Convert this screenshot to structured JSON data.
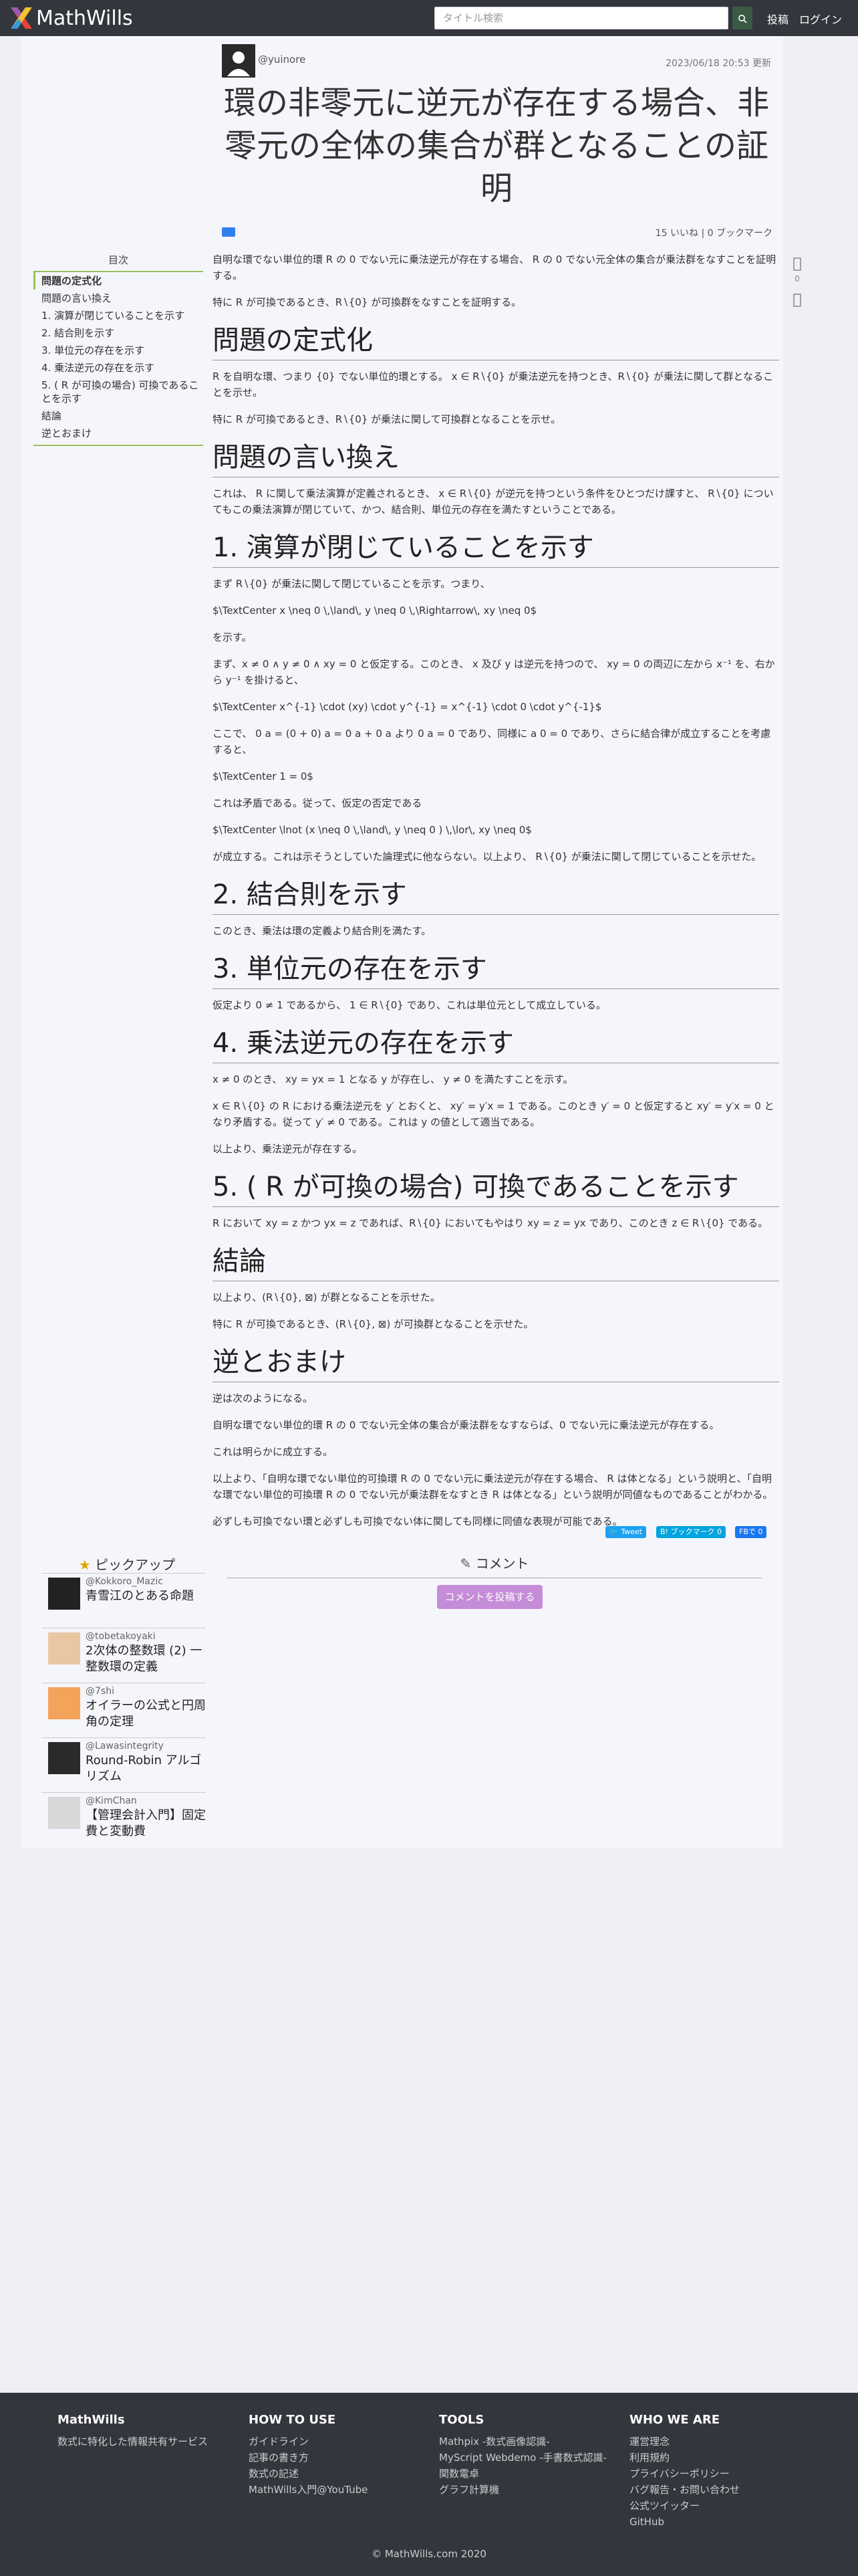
{
  "header": {
    "brand": "MathWills",
    "search_placeholder": "タイトル検索",
    "post_label": "投稿",
    "login_label": "ログイン"
  },
  "article": {
    "author": "@yuinore",
    "updated": "2023/06/18 20:53 更新",
    "title": "環の非零元に逆元が存在する場合、非零元の全体の集合が群となることの証明",
    "likes": "15 いいね",
    "bookmarks": "0 ブックマーク",
    "blocks": [
      {
        "type": "p",
        "text": "自明な環でない単位的環 R の 0 でない元に乗法逆元が存在する場合、 R の 0 でない元全体の集合が乗法群をなすことを証明する。"
      },
      {
        "type": "p",
        "text": "特に R が可換であるとき、R∖{0} が可換群をなすことを証明する。"
      },
      {
        "type": "h2",
        "text": "問題の定式化"
      },
      {
        "type": "p",
        "text": "R を自明な環、つまり {0} でない単位的環とする。 x ∈ R∖{0} が乗法逆元を持つとき、R∖{0} が乗法に関して群となることを示せ。"
      },
      {
        "type": "p",
        "text": "特に R が可換であるとき、R∖{0} が乗法に関して可換群となることを示せ。"
      },
      {
        "type": "h2",
        "text": "問題の言い換え"
      },
      {
        "type": "p",
        "text": "これは、 R に関して乗法演算が定義されるとき、 x ∈ R∖{0} が逆元を持つという条件をひとつだけ課すと、 R∖{0} についてもこの乗法演算が閉じていて、かつ、結合則、単位元の存在を満たすということである。"
      },
      {
        "type": "h2",
        "text": "1. 演算が閉じていることを示す"
      },
      {
        "type": "p",
        "text": "まず R∖{0} が乗法に関して閉じていることを示す。つまり、"
      },
      {
        "type": "p",
        "text": "$\\TextCenter x \\neq 0 \\,\\land\\, y \\neq 0 \\,\\Rightarrow\\, xy \\neq 0$"
      },
      {
        "type": "p",
        "text": "を示す。"
      },
      {
        "type": "p",
        "text": "まず、x ≠ 0 ∧ y ≠ 0 ∧ xy = 0 と仮定する。このとき、 x 及び y は逆元を持つので、 xy = 0 の両辺に左から x⁻¹ を、右から y⁻¹ を掛けると、"
      },
      {
        "type": "p",
        "text": "$\\TextCenter x^{-1} \\cdot (xy) \\cdot y^{-1} = x^{-1} \\cdot 0 \\cdot y^{-1}$"
      },
      {
        "type": "p",
        "text": "ここで、 0 a = (0 + 0) a = 0 a + 0 a より 0 a = 0 であり、同様に a 0 = 0 であり、さらに結合律が成立することを考慮すると、"
      },
      {
        "type": "p",
        "text": "$\\TextCenter 1 = 0$"
      },
      {
        "type": "p",
        "text": "これは矛盾である。従って、仮定の否定である"
      },
      {
        "type": "p",
        "text": "$\\TextCenter \\lnot (x \\neq 0 \\,\\land\\, y \\neq 0 ) \\,\\lor\\, xy \\neq 0$"
      },
      {
        "type": "p",
        "text": "が成立する。これは示そうとしていた論理式に他ならない。以上より、 R∖{0} が乗法に関して閉じていることを示せた。"
      },
      {
        "type": "h2",
        "text": "2. 結合則を示す"
      },
      {
        "type": "p",
        "text": "このとき、乗法は環の定義より結合則を満たす。"
      },
      {
        "type": "h2",
        "text": "3. 単位元の存在を示す"
      },
      {
        "type": "p",
        "text": "仮定より 0 ≠ 1 であるから、 1 ∈ R∖{0} であり、これは単位元として成立している。"
      },
      {
        "type": "h2",
        "text": "4. 乗法逆元の存在を示す"
      },
      {
        "type": "p",
        "text": "x ≠ 0 のとき、 xy = yx = 1 となる y が存在し、 y ≠ 0 を満たすことを示す。"
      },
      {
        "type": "p",
        "text": "x ∈ R∖{0} の R における乗法逆元を y′ とおくと、 xy′ = y′x = 1 である。このとき y′ = 0 と仮定すると xy′ = y′x = 0 となり矛盾する。従って y′ ≠ 0 である。これは y の値として適当である。"
      },
      {
        "type": "p",
        "text": "以上より、乗法逆元が存在する。"
      },
      {
        "type": "h2",
        "text": "5. ( R が可換の場合) 可換であることを示す"
      },
      {
        "type": "p",
        "text": "R において xy = z かつ yx = z であれば、R∖{0} においてもやはり xy = z = yx であり、このとき z ∈ R∖{0} である。"
      },
      {
        "type": "h2",
        "text": "結論"
      },
      {
        "type": "p",
        "text": "以上より、(R∖{0}, ⊠) が群となることを示せた。"
      },
      {
        "type": "p",
        "text": "特に R が可換であるとき、(R∖{0}, ⊠) が可換群となることを示せた。"
      },
      {
        "type": "h2",
        "text": "逆とおまけ"
      },
      {
        "type": "p",
        "text": "逆は次のようになる。"
      },
      {
        "type": "p",
        "text": "自明な環でない単位的環 R の 0 でない元全体の集合が乗法群をなすならば、0 でない元に乗法逆元が存在する。"
      },
      {
        "type": "p",
        "text": "これは明らかに成立する。"
      },
      {
        "type": "p",
        "text": "以上より、「自明な環でない単位的可換環 R の 0 でない元に乗法逆元が存在する場合、 R は体となる」という説明と、「自明な環でない単位的可換環 R の 0 でない元が乗法群をなすとき R は体となる」という説明が同値なものであることがわかる。"
      },
      {
        "type": "p",
        "text": "必ずしも可換でない環と必ずしも可換でない体に関しても同様に同値な表現が可能である。"
      }
    ]
  },
  "side": {
    "comment_count": "0"
  },
  "toc": {
    "title": "目次",
    "items": [
      {
        "label": "問題の定式化",
        "active": true
      },
      {
        "label": "問題の言い換え"
      },
      {
        "label": "1. 演算が閉じていることを示す"
      },
      {
        "label": "2. 結合則を示す"
      },
      {
        "label": "3. 単位元の存在を示す"
      },
      {
        "label": "4. 乗法逆元の存在を示す"
      },
      {
        "label": "5. ( R が可換の場合) 可換であることを示す"
      },
      {
        "label": "結論"
      },
      {
        "label": "逆とおまけ"
      }
    ]
  },
  "share": {
    "tweet": "Tweet",
    "hatena": "ブックマーク",
    "hatena_count": "0",
    "fb": "FBで 0"
  },
  "pickup": {
    "title": "ピックアップ",
    "items": [
      {
        "author": "@Kokkoro_Mazic",
        "title": "青雪江のとある命題"
      },
      {
        "author": "@tobetakoyaki",
        "title": "2次体の整数環 (2) 一整数環の定義"
      },
      {
        "author": "@7shi",
        "title": "オイラーの公式と円周角の定理"
      },
      {
        "author": "@Lawasintegrity",
        "title": "Round-Robin アルゴリズム"
      },
      {
        "author": "@KimChan",
        "title": "【管理会計入門】固定費と変動費"
      }
    ]
  },
  "comments": {
    "title": "コメント",
    "button": "コメントを投稿する"
  },
  "footer": {
    "cols": [
      {
        "head": "MathWills",
        "links": [
          "数式に特化した情報共有サービス"
        ]
      },
      {
        "head": "HOW TO USE",
        "links": [
          "ガイドライン",
          "記事の書き方",
          "数式の記述",
          "MathWills入門@YouTube"
        ]
      },
      {
        "head": "TOOLS",
        "links": [
          "Mathpix -数式画像認識-",
          "MyScript Webdemo -手書数式認識-",
          "関数電卓",
          "グラフ計算機"
        ]
      },
      {
        "head": "WHO WE ARE",
        "links": [
          "運営理念",
          "利用規約",
          "プライバシーポリシー",
          "バグ報告・お問い合わせ",
          "公式ツイッター",
          "GitHub"
        ]
      }
    ],
    "copyright": "© MathWills.com 2020"
  }
}
